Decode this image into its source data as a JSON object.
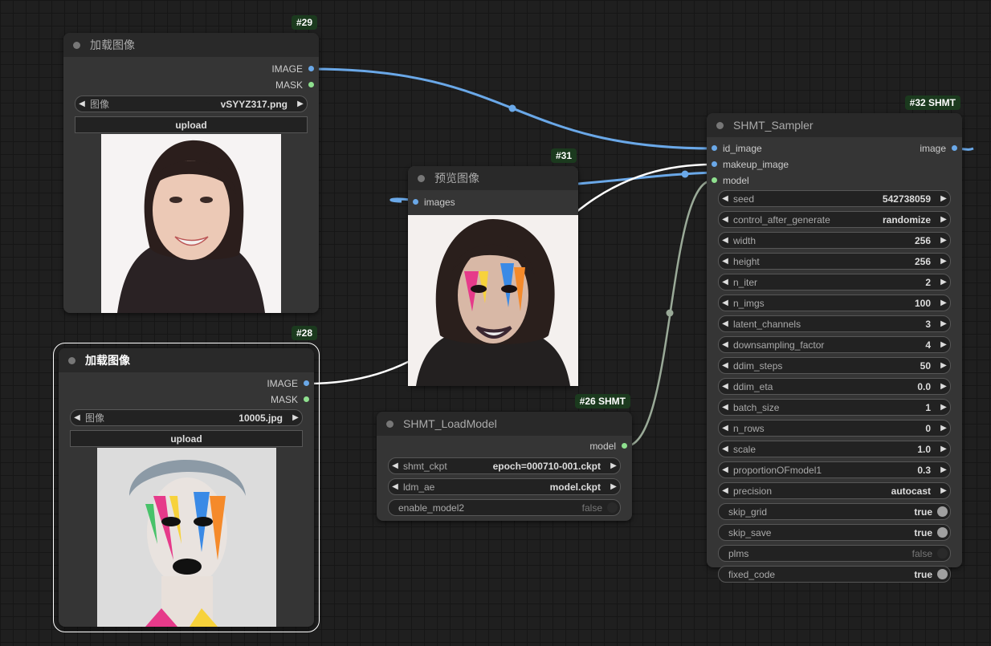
{
  "nodes": {
    "load1": {
      "badge": "#29",
      "title": "加载图像",
      "outputs": [
        "IMAGE",
        "MASK"
      ],
      "image_widget": {
        "label": "图像",
        "value": "vSYYZ317.png"
      },
      "upload_label": "upload"
    },
    "load2": {
      "badge": "#28",
      "title": "加载图像",
      "outputs": [
        "IMAGE",
        "MASK"
      ],
      "image_widget": {
        "label": "图像",
        "value": "10005.jpg"
      },
      "upload_label": "upload"
    },
    "preview": {
      "badge": "#31",
      "title": "预览图像",
      "input": "images"
    },
    "loadmodel": {
      "badge": "#26 SHMT",
      "title": "SHMT_LoadModel",
      "output": "model",
      "widgets": [
        {
          "label": "shmt_ckpt",
          "value": "epoch=000710-001.ckpt"
        },
        {
          "label": "ldm_ae",
          "value": "model.ckpt"
        }
      ],
      "toggle": {
        "label": "enable_model2",
        "value": "false"
      }
    },
    "sampler": {
      "badge": "#32 SHMT",
      "title": "SHMT_Sampler",
      "inputs": [
        "id_image",
        "makeup_image",
        "model"
      ],
      "output": "image",
      "widgets": [
        {
          "label": "seed",
          "value": "542738059"
        },
        {
          "label": "control_after_generate",
          "value": "randomize"
        },
        {
          "label": "width",
          "value": "256"
        },
        {
          "label": "height",
          "value": "256"
        },
        {
          "label": "n_iter",
          "value": "2"
        },
        {
          "label": "n_imgs",
          "value": "100"
        },
        {
          "label": "latent_channels",
          "value": "3"
        },
        {
          "label": "downsampling_factor",
          "value": "4"
        },
        {
          "label": "ddim_steps",
          "value": "50"
        },
        {
          "label": "ddim_eta",
          "value": "0.0"
        },
        {
          "label": "batch_size",
          "value": "1"
        },
        {
          "label": "n_rows",
          "value": "0"
        },
        {
          "label": "scale",
          "value": "1.0"
        },
        {
          "label": "proportionOFmodel1",
          "value": "0.3"
        },
        {
          "label": "precision",
          "value": "autocast"
        }
      ],
      "toggles": [
        {
          "label": "skip_grid",
          "value": "true"
        },
        {
          "label": "skip_save",
          "value": "true"
        },
        {
          "label": "plms",
          "value": "false"
        },
        {
          "label": "fixed_code",
          "value": "true"
        }
      ]
    }
  },
  "colors": {
    "image_link": "#6aa8e8",
    "model_link": "#9aaa98",
    "makeup_link": "#ffffff",
    "badge_bg": "#1b3a1e"
  }
}
